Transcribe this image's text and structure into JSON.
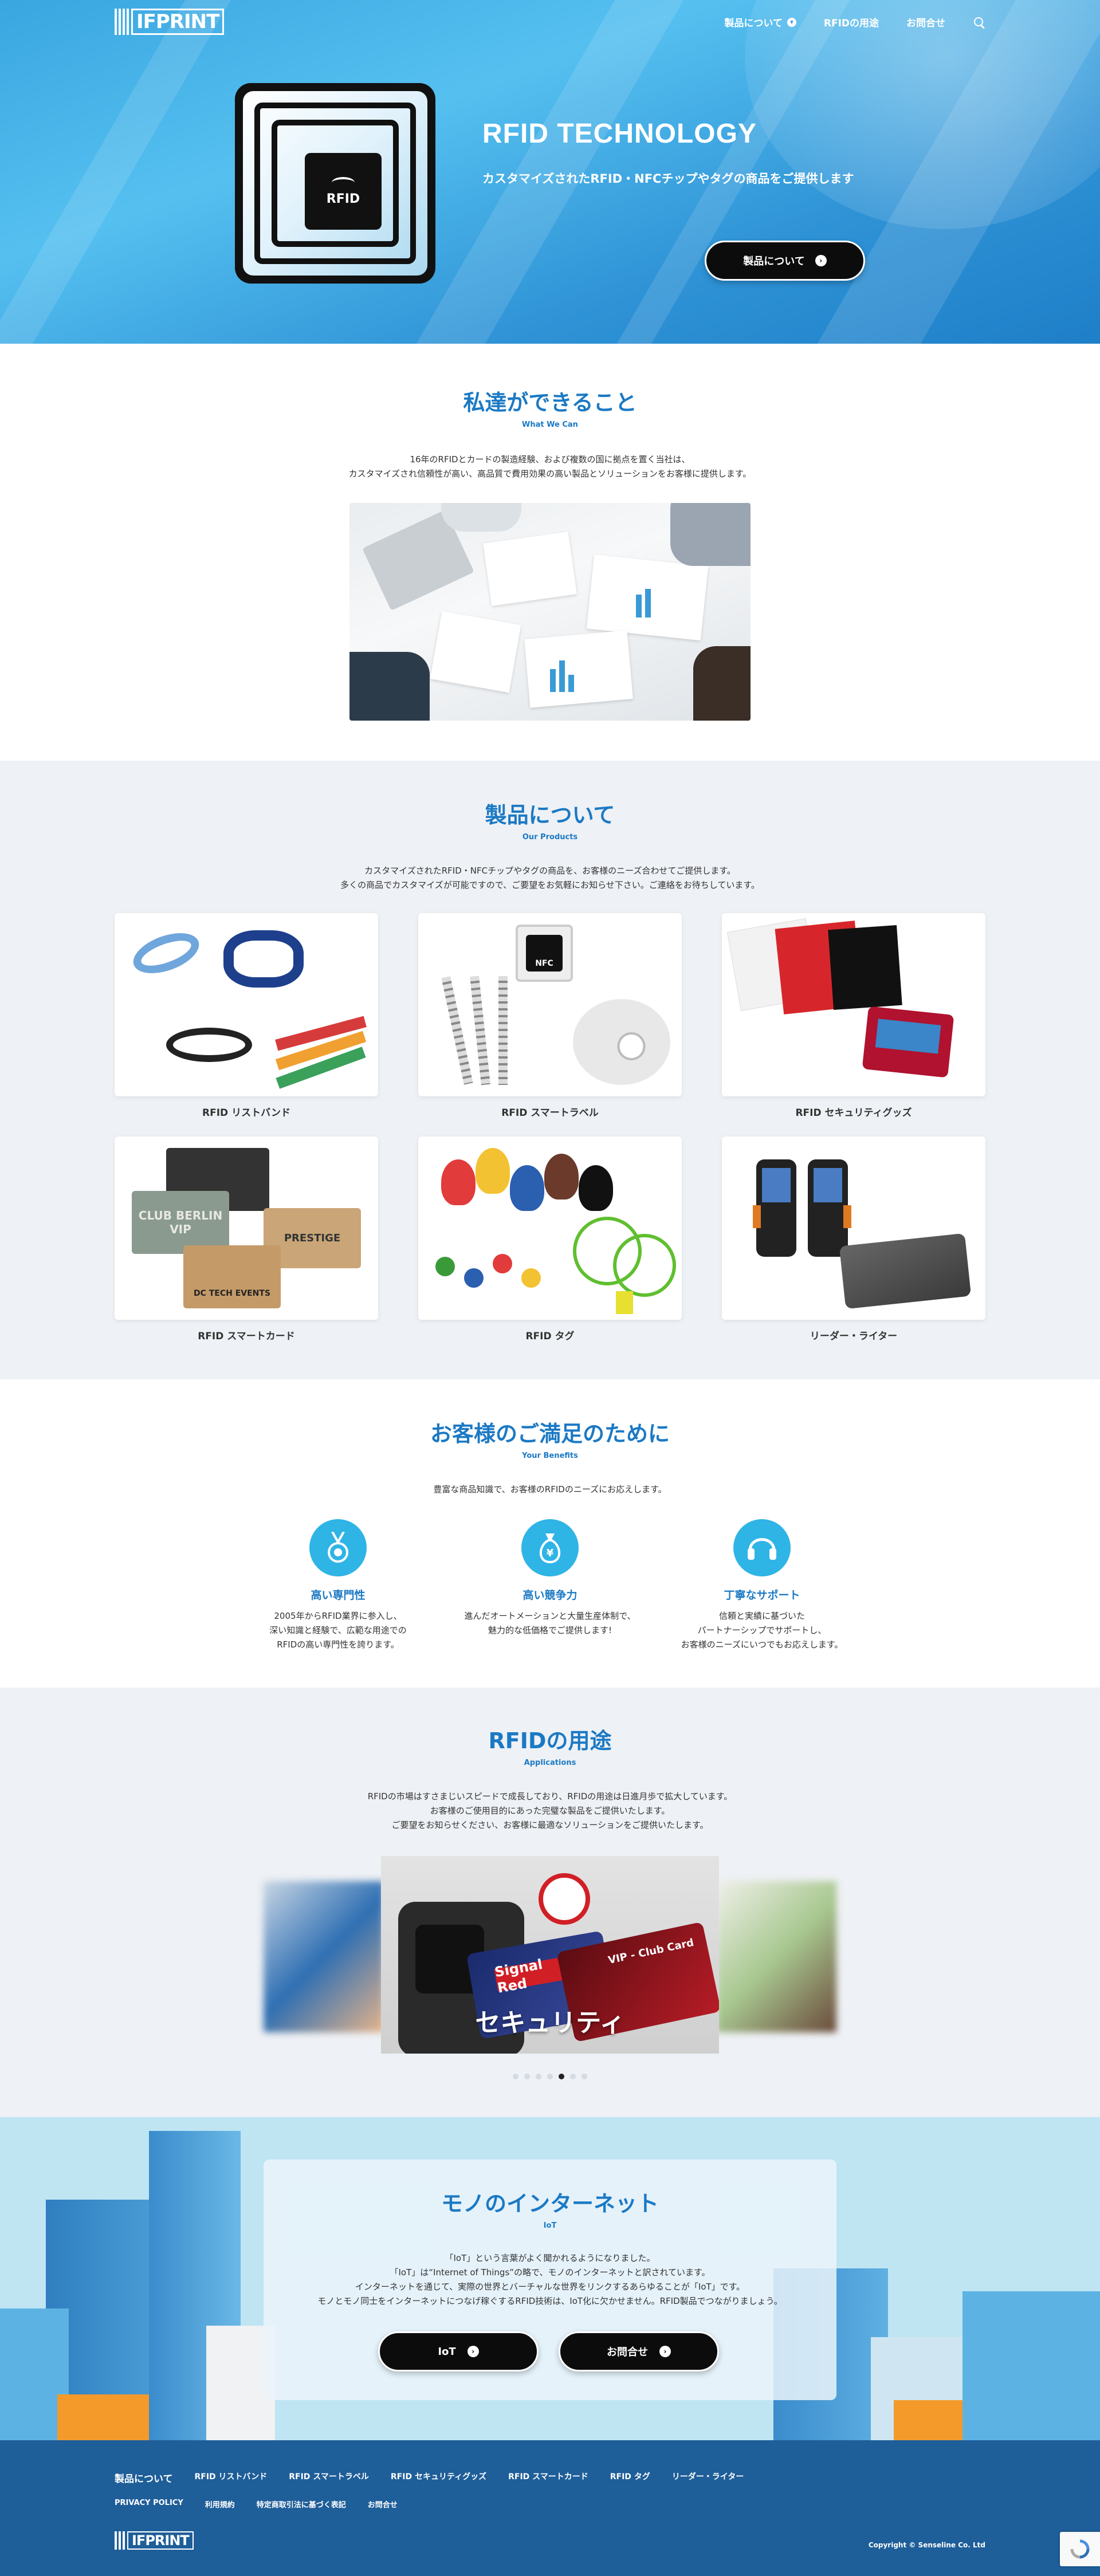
{
  "header": {
    "logo_text": "IFPRINT",
    "nav": [
      {
        "label": "製品について"
      },
      {
        "label": "RFIDの用途"
      },
      {
        "label": "お問合せ"
      }
    ]
  },
  "hero": {
    "chip_text": "RFID",
    "title": "RFID TECHNOLOGY",
    "subtitle": "カスタマイズされたRFID・NFCチップやタグの商品をご提供します",
    "button_label": "製品について"
  },
  "what": {
    "title": "私達ができること",
    "subtitle": "What We Can",
    "lines": [
      "16年のRFIDとカードの製造経験、および複数の国に拠点を置く当社は、",
      "カスタマイズされ信頼性が高い、高品質で費用効果の高い製品とソリューションをお客様に提供します。"
    ]
  },
  "products": {
    "title": "製品について",
    "subtitle": "Our Products",
    "lines": [
      "カスタマイズされたRFID・NFCチップやタグの商品を、お客様のニーズ合わせてご提供します。",
      "多くの商品でカスタマイズが可能ですので、ご要望をお気軽にお知らせ下さい。ご連絡をお待ちしています。"
    ],
    "items": [
      {
        "label": "RFID リストバンド"
      },
      {
        "label": "RFID スマートラベル"
      },
      {
        "label": "RFID セキュリティグッズ"
      },
      {
        "label": "RFID スマートカード"
      },
      {
        "label": "RFID タグ"
      },
      {
        "label": "リーダー・ライター"
      }
    ],
    "card_texts": {
      "nfc": "NFC",
      "card1": "CLUB BERLIN",
      "card1b": "VIP",
      "card2": "PRESTIGE",
      "card3": "DC TECH EVENTS"
    }
  },
  "benefits": {
    "title": "お客様のご満足のために",
    "subtitle": "Your Benefits",
    "intro": "豊富な商品知識で、お客様のRFIDのニーズにお応えします。",
    "items": [
      {
        "title": "高い専門性",
        "lines": [
          "2005年からRFID業界に参入し、",
          "深い知識と経験で、広範な用途での",
          "RFIDの高い専門性を誇ります。"
        ]
      },
      {
        "title": "高い競争力",
        "lines": [
          "進んだオートメーションと大量生産体制で、",
          "魅力的な低価格でご提供します!"
        ]
      },
      {
        "title": "丁寧なサポート",
        "lines": [
          "信頼と実績に基づいた",
          "パートナーシップでサポートし、",
          "お客様のニーズにいつでもお応えします。"
        ]
      }
    ]
  },
  "apps": {
    "title": "RFIDの用途",
    "subtitle": "Applications",
    "lines": [
      "RFIDの市場はすさまじいスピードで成長しており、RFIDの用途は日進月歩で拡大しています。",
      "お客様のご使用目的にあった完璧な製品をご提供いたします。",
      "ご要望をお知らせください、お客様に最適なソリューションをご提供いたします。"
    ],
    "slide_caption": "セキュリティ",
    "card_red": "Signal Red",
    "card_vip": "VIP - Club Card",
    "slide_count": 7,
    "active_slide": 4
  },
  "iot": {
    "title": "モノのインターネット",
    "subtitle": "IoT",
    "lines": [
      "「IoT」という言葉がよく聞かれるようになりました。",
      "「IoT」は“Internet of Things”の略で、モノのインターネットと訳されています。",
      "インターネットを通じて、実際の世界とバーチャルな世界をリンクするあらゆることが「IoT」です。",
      "モノとモノ同士をインターネットにつなげ稼ぐするRFID技術は、IoT化に欠かせません。RFID製品でつながりましょう。"
    ],
    "btn_iot": "IoT",
    "btn_contact": "お問合せ"
  },
  "footer": {
    "row1": [
      "製品について",
      "RFID リストバンド",
      "RFID スマートラベル",
      "RFID セキュリティグッズ",
      "RFID スマートカード",
      "RFID タグ",
      "リーダー・ライター"
    ],
    "row2": [
      "PRIVACY POLICY",
      "利用規約",
      "特定商取引法に基づく表記",
      "お問合せ"
    ],
    "logo_text": "IFPRINT",
    "copyright": "Copyright © Senseline Co. Ltd"
  },
  "colors": {
    "accent": "#1b79c4",
    "hero": "#3aa6e0",
    "footer": "#1e5e99",
    "icon_circle": "#2fb4e6"
  }
}
